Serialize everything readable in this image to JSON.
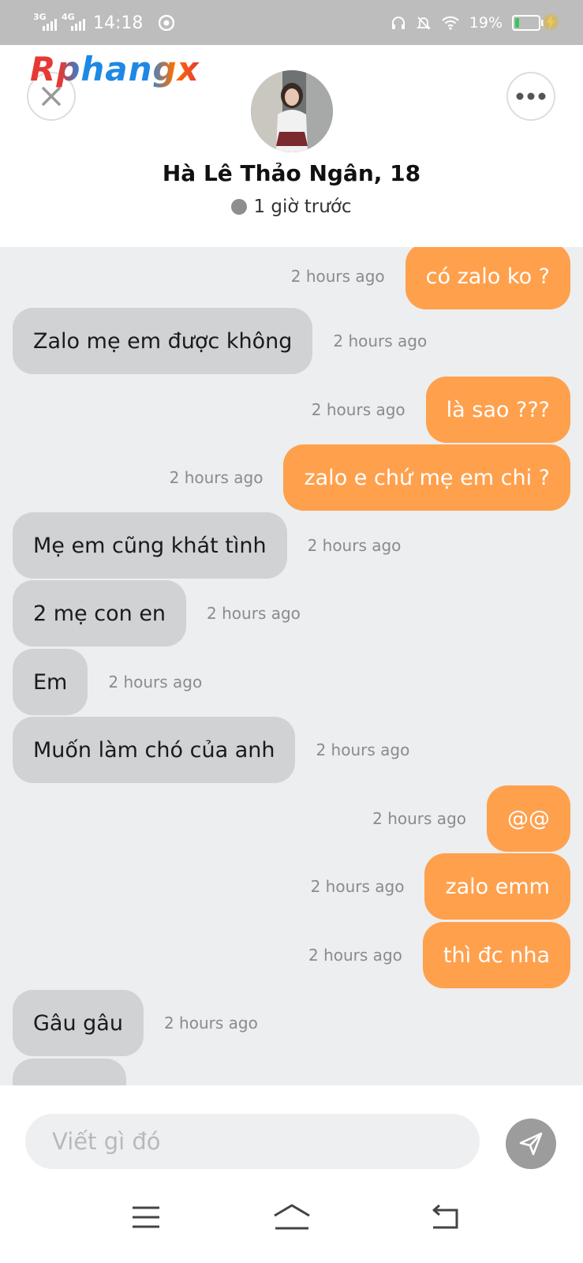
{
  "status_bar": {
    "net1": "3G",
    "net2": "4G",
    "time": "14:18",
    "battery_text": "19%",
    "battery_level": 0.19,
    "icons": [
      "headphones-icon",
      "bell-off-icon",
      "wifi-icon",
      "battery-icon",
      "charging-bolt-icon",
      "chrome-icon"
    ]
  },
  "watermark": "Rphangx",
  "header": {
    "contact_name": "Hà Lê Thảo Ngân, 18",
    "last_seen": "1 giờ trước"
  },
  "messages": [
    {
      "dir": "out",
      "text": "có zalo ko ?",
      "time": "2 hours ago"
    },
    {
      "dir": "in",
      "text": "Zalo mẹ em được không",
      "time": "2 hours ago"
    },
    {
      "dir": "out",
      "text": "là sao ???",
      "time": "2 hours ago"
    },
    {
      "dir": "out",
      "text": "zalo e chứ mẹ em chi ?",
      "time": "2 hours ago"
    },
    {
      "dir": "in",
      "text": "Mẹ em cũng khát tình",
      "time": "2 hours ago"
    },
    {
      "dir": "in",
      "text": "2 mẹ con en",
      "time": "2 hours ago"
    },
    {
      "dir": "in",
      "text": "Em",
      "time": "2 hours ago"
    },
    {
      "dir": "in",
      "text": "Muốn làm chó của anh",
      "time": "2 hours ago"
    },
    {
      "dir": "out",
      "text": "@@",
      "time": "2 hours ago"
    },
    {
      "dir": "out",
      "text": "zalo emm",
      "time": "2 hours ago"
    },
    {
      "dir": "out",
      "text": "thì đc nha",
      "time": "2 hours ago"
    },
    {
      "dir": "in",
      "text": "Gâu gâu",
      "time": "2 hours ago"
    }
  ],
  "composer": {
    "placeholder": "Viết gì đó",
    "value": ""
  },
  "colors": {
    "outgoing_bubble": "#ffa04d",
    "incoming_bubble": "#d0d2d3",
    "chat_background": "#eceeef"
  }
}
